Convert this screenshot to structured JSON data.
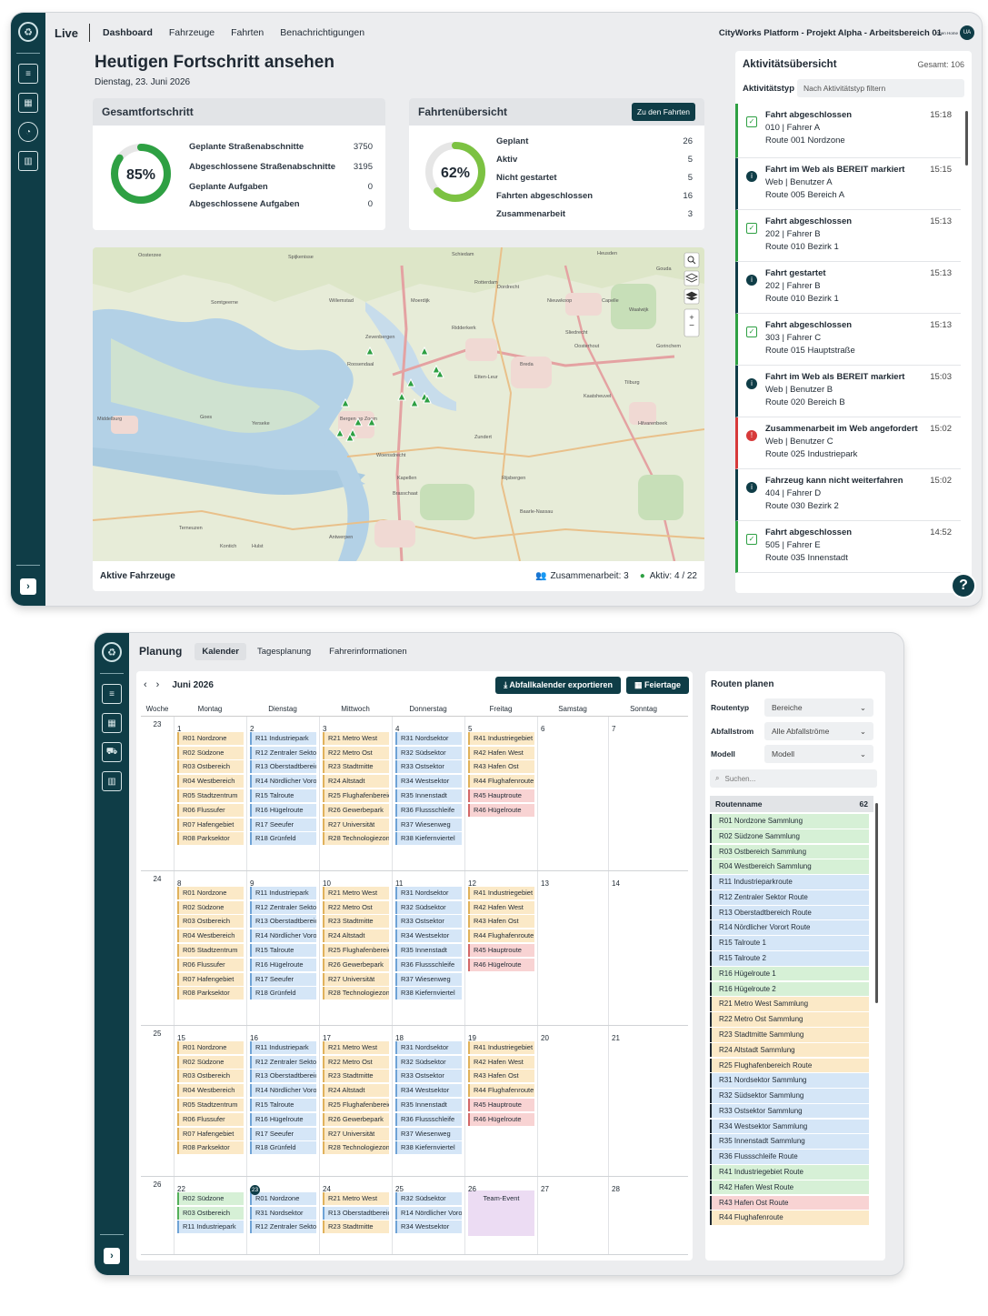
{
  "live": {
    "tab_live": "Live",
    "nav": [
      "Dashboard",
      "Fahrzeuge",
      "Fahrten",
      "Benachrichtigungen"
    ],
    "project_title": "CityWorks Platform - Projekt Alpha - Arbeitsbereich 01",
    "user_small": "Open Home",
    "user_initials": "UA",
    "page_title": "Heutigen Fortschritt ansehen",
    "date": "Dienstag, 23. Juni 2026",
    "overall": {
      "title": "Gesamtfortschritt",
      "percent_label": "85%",
      "percent": 0.85,
      "rows": [
        {
          "label": "Geplante Straßenabschnitte",
          "value": "3750"
        },
        {
          "label": "Abgeschlossene Straßenabschnitte",
          "value": "3195"
        },
        {
          "label": "Geplante Aufgaben",
          "value": "0"
        },
        {
          "label": "Abgeschlossene Aufgaben",
          "value": "0"
        }
      ]
    },
    "trips": {
      "title": "Fahrtenübersicht",
      "button": "Zu den Fahrten",
      "percent_label": "62%",
      "percent": 0.62,
      "rows": [
        {
          "label": "Geplant",
          "value": "26"
        },
        {
          "label": "Aktiv",
          "value": "5"
        },
        {
          "label": "Nicht gestartet",
          "value": "5"
        },
        {
          "label": "Fahrten abgeschlossen",
          "value": "16"
        },
        {
          "label": "Zusammenarbeit",
          "value": "3"
        }
      ]
    },
    "map": {
      "labels": [
        "Oosterzee",
        "Schiedam",
        "Spijkenisse",
        "Rotterdam",
        "Capelle",
        "Gouda",
        "Ridderkerk",
        "Dordrecht",
        "Sliedrecht",
        "Gorinchem",
        "Breda",
        "Tilburg",
        "Oosterhout",
        "Roosendaal",
        "Bergen op Zoom",
        "Woensdrecht",
        "Middelburg",
        "Goes",
        "Yerseke",
        "Hulst",
        "Antwerpen",
        "Kontich",
        "Kapellen",
        "Brasschaat",
        "Zundert",
        "Rijsbergen",
        "Baarle-Nassau",
        "Hilvarenbeek",
        "Etten-Leur",
        "Zevenbergen",
        "Moerdijk",
        "Willemstad",
        "Kaatsheuvel",
        "Waalwijk",
        "Heusden",
        "Nieuwkoop",
        "Somtgeerne",
        "Terneuzen"
      ],
      "footer_label": "Aktive Fahrzeuge",
      "collab": "Zusammenarbeit: 3",
      "active": "Aktiv: 4 / 22"
    },
    "feed": {
      "title": "Aktivitätsübersicht",
      "total": "Gesamt: 106",
      "filter_label": "Aktivitätstyp",
      "filter_placeholder": "Nach Aktivitätstyp filtern",
      "items": [
        {
          "title": "Fahrt abgeschlossen",
          "l1": "010 | Fahrer A",
          "l2": "Route 001 Nordzone",
          "time": "15:18",
          "kind": "done"
        },
        {
          "title": "Fahrt im Web als BEREIT markiert",
          "l1": "Web | Benutzer A",
          "l2": "Route 005 Bereich A",
          "time": "15:15",
          "kind": "info"
        },
        {
          "title": "Fahrt abgeschlossen",
          "l1": "202 | Fahrer B",
          "l2": "Route 010 Bezirk 1",
          "time": "15:13",
          "kind": "done"
        },
        {
          "title": "Fahrt gestartet",
          "l1": "202 | Fahrer B",
          "l2": "Route 010 Bezirk 1",
          "time": "15:13",
          "kind": "info"
        },
        {
          "title": "Fahrt abgeschlossen",
          "l1": "303 | Fahrer C",
          "l2": "Route 015 Hauptstraße",
          "time": "15:13",
          "kind": "done"
        },
        {
          "title": "Fahrt im Web als BEREIT markiert",
          "l1": "Web | Benutzer B",
          "l2": "Route 020 Bereich B",
          "time": "15:03",
          "kind": "info"
        },
        {
          "title": "Zusammenarbeit im Web angefordert",
          "l1": "Web | Benutzer C",
          "l2": "Route 025 Industriepark",
          "time": "15:02",
          "kind": "alert"
        },
        {
          "title": "Fahrzeug kann nicht weiterfahren",
          "l1": "404 | Fahrer D",
          "l2": "Route 030 Bezirk 2",
          "time": "15:02",
          "kind": "info"
        },
        {
          "title": "Fahrt abgeschlossen",
          "l1": "505 | Fahrer E",
          "l2": "Route 035 Innenstadt",
          "time": "14:52",
          "kind": "done"
        }
      ],
      "help": "?"
    }
  },
  "planning": {
    "title": "Planung",
    "tabs": [
      "Kalender",
      "Tagesplanung",
      "Fahrerinformationen"
    ],
    "month": "Juni 2026",
    "export_btn": "Abfallkalender exportieren",
    "holiday_btn": "Feiertage",
    "weekdays": [
      "Woche",
      "Montag",
      "Dienstag",
      "Mittwoch",
      "Donnerstag",
      "Freitag",
      "Samstag",
      "Sonntag"
    ],
    "weeks": [
      {
        "num": "23",
        "days": [
          "1",
          "2",
          "3",
          "4",
          "5",
          "6",
          "7"
        ]
      },
      {
        "num": "24",
        "days": [
          "8",
          "9",
          "10",
          "11",
          "12",
          "13",
          "14"
        ]
      },
      {
        "num": "25",
        "days": [
          "15",
          "16",
          "17",
          "18",
          "19",
          "20",
          "21"
        ]
      },
      {
        "num": "26",
        "days": [
          "22",
          "23",
          "24",
          "25",
          "26",
          "27",
          "28"
        ]
      }
    ],
    "full_week": {
      "mon": [
        "R01 Nordzone",
        "R02 Südzone",
        "R03 Ostbereich",
        "R04 Westbereich",
        "R05 Stadtzentrum",
        "R06 Flussufer",
        "R07 Hafengebiet",
        "R08 Parksektor"
      ],
      "tue": [
        "R11 Industriepark",
        "R12 Zentraler Sektor",
        "R13 Oberstadtbereich",
        "R14 Nördlicher Vorort",
        "R15 Talroute",
        "R16 Hügelroute",
        "R17 Seeufer",
        "R18 Grünfeld"
      ],
      "wed": [
        "R21 Metro West",
        "R22 Metro Ost",
        "R23 Stadtmitte",
        "R24 Altstadt",
        "R25 Flughafenbereich",
        "R26 Gewerbepark",
        "R27 Universität",
        "R28 Technologiezone"
      ],
      "thu": [
        "R31 Nordsektor",
        "R32 Südsektor",
        "R33 Ostsektor",
        "R34 Westsektor",
        "R35 Innenstadt",
        "R36 Flussschleife",
        "R37 Wiesenweg",
        "R38 Kiefernviertel"
      ],
      "fri": [
        "R41 Industriegebiet",
        "R42 Hafen West",
        "R43 Hafen Ost",
        "R44 Flughafenroute",
        "R45 Hauptroute",
        "R46 Hügelroute"
      ]
    },
    "last_week": {
      "mon": [
        "R02 Südzone",
        "R03 Ostbereich",
        "R11 Industriepark"
      ],
      "tue": [
        "R01 Nordzone",
        "R31 Nordsektor",
        "R12 Zentraler Sektor"
      ],
      "wed": [
        "R21 Metro West",
        "R13 Oberstadtbereich",
        "R23 Stadtmitte"
      ],
      "thu": [
        "R32 Südsektor",
        "R14 Nördlicher Vorort",
        "R34 Westsektor"
      ],
      "fri_event": "Team-Event"
    },
    "routes_panel": {
      "title": "Routen planen",
      "routetype_label": "Routentyp",
      "routetype_value": "Bereiche",
      "stream_label": "Abfallstrom",
      "stream_value": "Alle Abfallströme",
      "model_label": "Modell",
      "model_value": "Modell",
      "search_placeholder": "Suchen...",
      "list_header": "Routenname",
      "count": "62",
      "routes": [
        {
          "name": "R01 Nordzone Sammlung",
          "c": "g"
        },
        {
          "name": "R02 Südzone Sammlung",
          "c": "g"
        },
        {
          "name": "R03 Ostbereich Sammlung",
          "c": "g"
        },
        {
          "name": "R04 Westbereich Sammlung",
          "c": "g"
        },
        {
          "name": "R11 Industrieparkroute",
          "c": "b"
        },
        {
          "name": "R12 Zentraler Sektor Route",
          "c": "b"
        },
        {
          "name": "R13 Oberstadtbereich Route",
          "c": "b"
        },
        {
          "name": "R14 Nördlicher Vorort Route",
          "c": "b"
        },
        {
          "name": "R15 Talroute 1",
          "c": "b"
        },
        {
          "name": "R15 Talroute 2",
          "c": "b"
        },
        {
          "name": "R16 Hügelroute 1",
          "c": "g"
        },
        {
          "name": "R16 Hügelroute 2",
          "c": "g"
        },
        {
          "name": "R21 Metro West Sammlung",
          "c": "y"
        },
        {
          "name": "R22 Metro Ost Sammlung",
          "c": "y"
        },
        {
          "name": "R23 Stadtmitte Sammlung",
          "c": "y"
        },
        {
          "name": "R24 Altstadt Sammlung",
          "c": "y"
        },
        {
          "name": "R25 Flughafenbereich Route",
          "c": "y"
        },
        {
          "name": "R31 Nordsektor Sammlung",
          "c": "b"
        },
        {
          "name": "R32 Südsektor Sammlung",
          "c": "b"
        },
        {
          "name": "R33 Ostsektor Sammlung",
          "c": "b"
        },
        {
          "name": "R34 Westsektor Sammlung",
          "c": "b"
        },
        {
          "name": "R35 Innenstadt Sammlung",
          "c": "b"
        },
        {
          "name": "R36 Flussschleife Route",
          "c": "b"
        },
        {
          "name": "R41 Industriegebiet Route",
          "c": "g"
        },
        {
          "name": "R42 Hafen West Route",
          "c": "g"
        },
        {
          "name": "R43 Hafen Ost Route",
          "c": "r"
        },
        {
          "name": "R44 Flughafenroute",
          "c": "y"
        }
      ]
    }
  },
  "colors": {
    "sidebar": "#0f3d47",
    "accent": "#0f3d47",
    "green": "#2ea043",
    "blue": "#1f5fbf",
    "red": "#d73a3a"
  }
}
